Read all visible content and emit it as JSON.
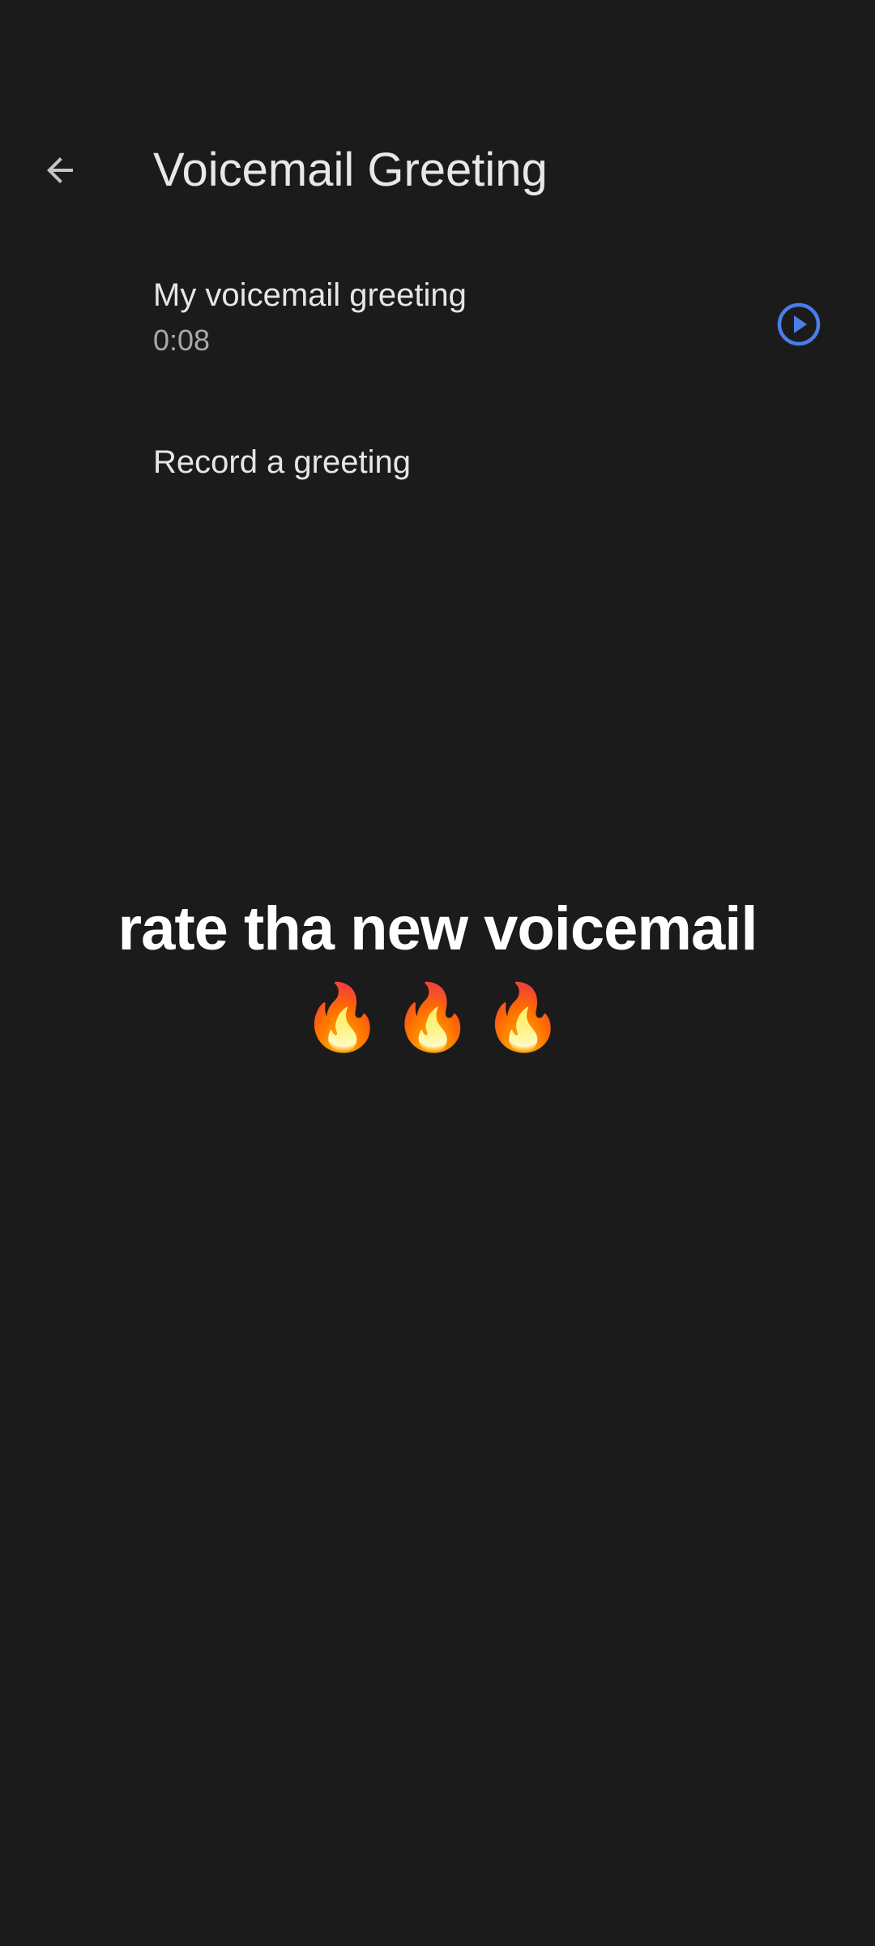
{
  "header": {
    "title": "Voicemail Greeting",
    "back_icon": "arrow-back-icon"
  },
  "greeting": {
    "title": "My voicemail greeting",
    "duration": "0:08",
    "play_icon": "play-circle-icon"
  },
  "record": {
    "label": "Record a greeting"
  },
  "caption": {
    "text": "rate tha new voicemail",
    "emoji": "🔥🔥🔥"
  },
  "colors": {
    "background": "#1b1b1c",
    "accent": "#4a7ee8",
    "text_primary": "#e6e6e6",
    "text_secondary": "#a9a9a9"
  }
}
